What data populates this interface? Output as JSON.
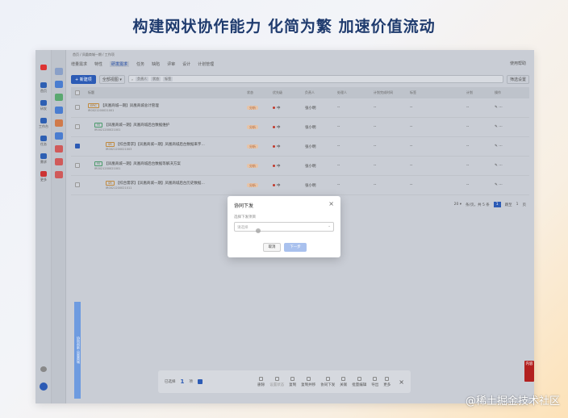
{
  "hero": {
    "title": "构建网状协作能力 化简为繁 加速价值流动"
  },
  "app": {
    "breadcrumb": "首页 / 凤凰商城一期 / 工作项",
    "tabs": [
      "增量需求",
      "特性",
      "研发需求",
      "任务",
      "缺陷",
      "评审",
      "设计",
      "计划管理"
    ],
    "active_tab": "研发需求",
    "help": "使用帮助",
    "toolbar": {
      "new_label": "+ 新建项",
      "view_label": "全部视图 ▾",
      "adv_label": "筛选设置"
    },
    "rail": [
      "首页",
      "研发",
      "工作台",
      "任务",
      "需求",
      "更多"
    ],
    "table": {
      "headers": [
        "标题",
        "状态",
        "优先级",
        "负责人",
        "处理人",
        "计划完成时间",
        "标签",
        "",
        "计划",
        "操作"
      ],
      "rows": [
        {
          "tag": "EPIC",
          "title": "【凤凰商城一期】凤凰商城总计管理",
          "code": "IR0021200021001",
          "status": "分析",
          "priority": "中",
          "owner": "张小明",
          "checked": false
        },
        {
          "tag": "FE",
          "title": "【凤凰商城一期】凤凰商城后台数据维护",
          "code": "IR0021200021001",
          "status": "分析",
          "priority": "中",
          "owner": "张小明",
          "checked": false
        },
        {
          "tag": "SR",
          "title": "【综合需求】【凤凰商城一期】凤凰商城后台数据来字…",
          "code": "IR0021200021003",
          "status": "分析",
          "priority": "中",
          "owner": "张小明",
          "checked": true
        },
        {
          "tag": "FE",
          "title": "【凤凰商城一期】凤凰商城后台数据等解决方案",
          "code": "IR0021200021001",
          "status": "分析",
          "priority": "中",
          "owner": "张小明",
          "checked": false
        },
        {
          "tag": "SR",
          "title": "【综合需求】【凤凰商城一期】凤凰商城后台历史数据…",
          "code": "IR0021200021011",
          "status": "分析",
          "priority": "中",
          "owner": "张小明",
          "checked": false
        }
      ]
    },
    "pagination": {
      "size": "20 ▾",
      "total": "条/页，共 5 条",
      "current": "1",
      "jump_label": "跳至",
      "jump_value": "1",
      "unit": "页"
    }
  },
  "modal": {
    "title": "协同下发",
    "label": "选择下发项目",
    "placeholder": "请选择",
    "cancel": "取消",
    "confirm": "下一步",
    "close": "×"
  },
  "bottom_bar": {
    "selected_prefix": "已选择",
    "selected_count": "1",
    "selected_suffix": "项",
    "actions": [
      "删除",
      "设置状态",
      "复制",
      "复制并移",
      "协同下发",
      "关联",
      "批量编辑",
      "导出",
      "更多"
    ],
    "close": "×"
  },
  "side_pin": {
    "label": "协同创新 凤凰商城"
  },
  "seal": {
    "label": "内容"
  },
  "watermark": "@稀土掘金技术社区",
  "colors": {
    "accent": "#2c5bb5",
    "hero": "#1f3b6e",
    "seal": "#b2201f"
  }
}
